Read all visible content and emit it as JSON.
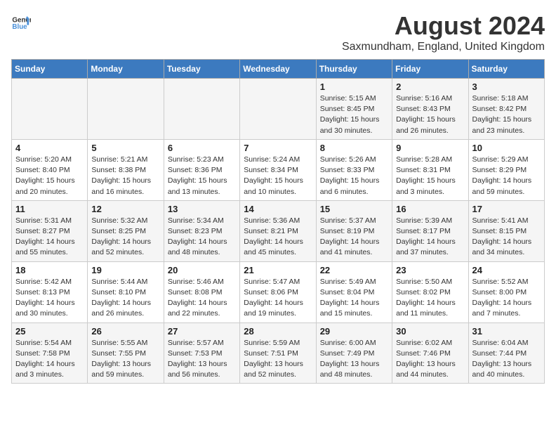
{
  "logo": {
    "line1": "General",
    "line2": "Blue"
  },
  "title": "August 2024",
  "subtitle": "Saxmundham, England, United Kingdom",
  "days_of_week": [
    "Sunday",
    "Monday",
    "Tuesday",
    "Wednesday",
    "Thursday",
    "Friday",
    "Saturday"
  ],
  "weeks": [
    {
      "days": [
        {
          "number": "",
          "detail": ""
        },
        {
          "number": "",
          "detail": ""
        },
        {
          "number": "",
          "detail": ""
        },
        {
          "number": "",
          "detail": ""
        },
        {
          "number": "1",
          "detail": "Sunrise: 5:15 AM\nSunset: 8:45 PM\nDaylight: 15 hours\nand 30 minutes."
        },
        {
          "number": "2",
          "detail": "Sunrise: 5:16 AM\nSunset: 8:43 PM\nDaylight: 15 hours\nand 26 minutes."
        },
        {
          "number": "3",
          "detail": "Sunrise: 5:18 AM\nSunset: 8:42 PM\nDaylight: 15 hours\nand 23 minutes."
        }
      ]
    },
    {
      "days": [
        {
          "number": "4",
          "detail": "Sunrise: 5:20 AM\nSunset: 8:40 PM\nDaylight: 15 hours\nand 20 minutes."
        },
        {
          "number": "5",
          "detail": "Sunrise: 5:21 AM\nSunset: 8:38 PM\nDaylight: 15 hours\nand 16 minutes."
        },
        {
          "number": "6",
          "detail": "Sunrise: 5:23 AM\nSunset: 8:36 PM\nDaylight: 15 hours\nand 13 minutes."
        },
        {
          "number": "7",
          "detail": "Sunrise: 5:24 AM\nSunset: 8:34 PM\nDaylight: 15 hours\nand 10 minutes."
        },
        {
          "number": "8",
          "detail": "Sunrise: 5:26 AM\nSunset: 8:33 PM\nDaylight: 15 hours\nand 6 minutes."
        },
        {
          "number": "9",
          "detail": "Sunrise: 5:28 AM\nSunset: 8:31 PM\nDaylight: 15 hours\nand 3 minutes."
        },
        {
          "number": "10",
          "detail": "Sunrise: 5:29 AM\nSunset: 8:29 PM\nDaylight: 14 hours\nand 59 minutes."
        }
      ]
    },
    {
      "days": [
        {
          "number": "11",
          "detail": "Sunrise: 5:31 AM\nSunset: 8:27 PM\nDaylight: 14 hours\nand 55 minutes."
        },
        {
          "number": "12",
          "detail": "Sunrise: 5:32 AM\nSunset: 8:25 PM\nDaylight: 14 hours\nand 52 minutes."
        },
        {
          "number": "13",
          "detail": "Sunrise: 5:34 AM\nSunset: 8:23 PM\nDaylight: 14 hours\nand 48 minutes."
        },
        {
          "number": "14",
          "detail": "Sunrise: 5:36 AM\nSunset: 8:21 PM\nDaylight: 14 hours\nand 45 minutes."
        },
        {
          "number": "15",
          "detail": "Sunrise: 5:37 AM\nSunset: 8:19 PM\nDaylight: 14 hours\nand 41 minutes."
        },
        {
          "number": "16",
          "detail": "Sunrise: 5:39 AM\nSunset: 8:17 PM\nDaylight: 14 hours\nand 37 minutes."
        },
        {
          "number": "17",
          "detail": "Sunrise: 5:41 AM\nSunset: 8:15 PM\nDaylight: 14 hours\nand 34 minutes."
        }
      ]
    },
    {
      "days": [
        {
          "number": "18",
          "detail": "Sunrise: 5:42 AM\nSunset: 8:13 PM\nDaylight: 14 hours\nand 30 minutes."
        },
        {
          "number": "19",
          "detail": "Sunrise: 5:44 AM\nSunset: 8:10 PM\nDaylight: 14 hours\nand 26 minutes."
        },
        {
          "number": "20",
          "detail": "Sunrise: 5:46 AM\nSunset: 8:08 PM\nDaylight: 14 hours\nand 22 minutes."
        },
        {
          "number": "21",
          "detail": "Sunrise: 5:47 AM\nSunset: 8:06 PM\nDaylight: 14 hours\nand 19 minutes."
        },
        {
          "number": "22",
          "detail": "Sunrise: 5:49 AM\nSunset: 8:04 PM\nDaylight: 14 hours\nand 15 minutes."
        },
        {
          "number": "23",
          "detail": "Sunrise: 5:50 AM\nSunset: 8:02 PM\nDaylight: 14 hours\nand 11 minutes."
        },
        {
          "number": "24",
          "detail": "Sunrise: 5:52 AM\nSunset: 8:00 PM\nDaylight: 14 hours\nand 7 minutes."
        }
      ]
    },
    {
      "days": [
        {
          "number": "25",
          "detail": "Sunrise: 5:54 AM\nSunset: 7:58 PM\nDaylight: 14 hours\nand 3 minutes."
        },
        {
          "number": "26",
          "detail": "Sunrise: 5:55 AM\nSunset: 7:55 PM\nDaylight: 13 hours\nand 59 minutes."
        },
        {
          "number": "27",
          "detail": "Sunrise: 5:57 AM\nSunset: 7:53 PM\nDaylight: 13 hours\nand 56 minutes."
        },
        {
          "number": "28",
          "detail": "Sunrise: 5:59 AM\nSunset: 7:51 PM\nDaylight: 13 hours\nand 52 minutes."
        },
        {
          "number": "29",
          "detail": "Sunrise: 6:00 AM\nSunset: 7:49 PM\nDaylight: 13 hours\nand 48 minutes."
        },
        {
          "number": "30",
          "detail": "Sunrise: 6:02 AM\nSunset: 7:46 PM\nDaylight: 13 hours\nand 44 minutes."
        },
        {
          "number": "31",
          "detail": "Sunrise: 6:04 AM\nSunset: 7:44 PM\nDaylight: 13 hours\nand 40 minutes."
        }
      ]
    }
  ]
}
